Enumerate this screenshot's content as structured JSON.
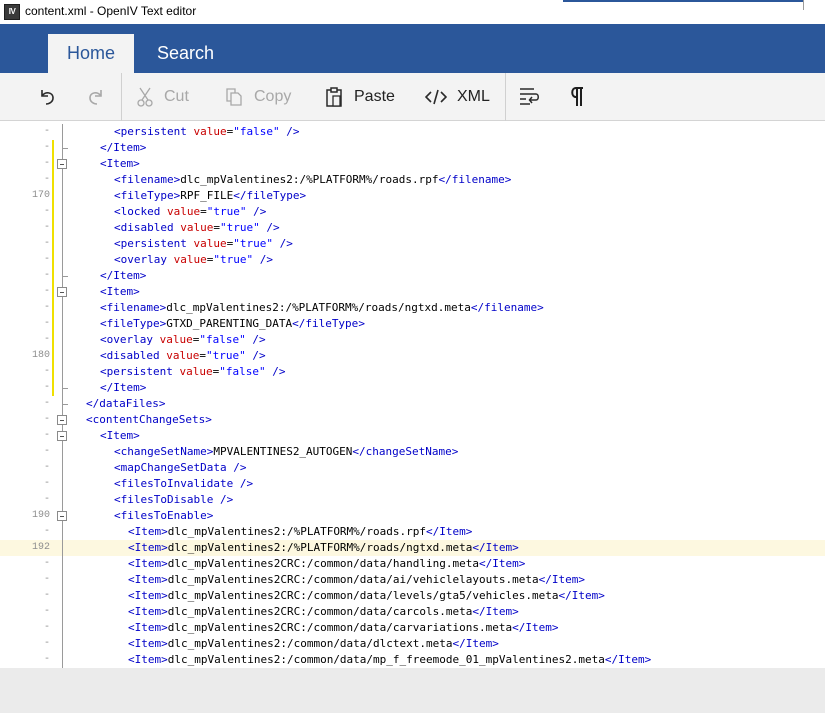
{
  "window": {
    "title": "content.xml - OpenIV Text editor",
    "icon_text": "IV"
  },
  "tabs": [
    {
      "label": "Home",
      "active": true
    },
    {
      "label": "Search",
      "active": false
    }
  ],
  "toolbar": {
    "undo_icon": "undo-icon",
    "redo_icon": "redo-icon",
    "cut_label": "Cut",
    "copy_label": "Copy",
    "paste_label": "Paste",
    "xml_label": "XML",
    "wrap_icon": "word-wrap-icon",
    "pilcrow_icon": "show-formatting-icon"
  },
  "colors": {
    "ribbon": "#2b579a",
    "tag": "#0000c8",
    "attr": "#c80000",
    "value": "#0000ff",
    "change_marker": "#f0e000",
    "current_line": "#fdf8e0"
  },
  "editor": {
    "current_line": 192,
    "lines": [
      {
        "n": "-",
        "depth": 2,
        "text": "<persistent value=\"false\" />"
      },
      {
        "n": "-",
        "depth": 1,
        "text": "</Item>"
      },
      {
        "n": "-",
        "depth": 1,
        "text": "<Item>"
      },
      {
        "n": "-",
        "depth": 2,
        "text": "<filename>dlc_mpValentines2:/%PLATFORM%/roads.rpf</filename>"
      },
      {
        "n": "170",
        "depth": 2,
        "text": "<fileType>RPF_FILE</fileType>"
      },
      {
        "n": "-",
        "depth": 2,
        "text": "<locked value=\"true\" />"
      },
      {
        "n": "-",
        "depth": 2,
        "text": "<disabled value=\"true\" />"
      },
      {
        "n": "-",
        "depth": 2,
        "text": "<persistent value=\"true\" />"
      },
      {
        "n": "-",
        "depth": 2,
        "text": "<overlay value=\"true\" />"
      },
      {
        "n": "-",
        "depth": 1,
        "text": "</Item>"
      },
      {
        "n": "-",
        "depth": 1,
        "text": "<Item>"
      },
      {
        "n": "-",
        "depth": 1,
        "text": "<filename>dlc_mpValentines2:/%PLATFORM%/roads/ngtxd.meta</filename>"
      },
      {
        "n": "-",
        "depth": 1,
        "text": "<fileType>GTXD_PARENTING_DATA</fileType>"
      },
      {
        "n": "-",
        "depth": 1,
        "text": "<overlay value=\"false\" />"
      },
      {
        "n": "180",
        "depth": 1,
        "text": "<disabled value=\"true\" />"
      },
      {
        "n": "-",
        "depth": 1,
        "text": "<persistent value=\"false\" />"
      },
      {
        "n": "-",
        "depth": 1,
        "text": "</Item>"
      },
      {
        "n": "-",
        "depth": 0,
        "text": "</dataFiles>"
      },
      {
        "n": "-",
        "depth": 0,
        "text": "<contentChangeSets>"
      },
      {
        "n": "-",
        "depth": 1,
        "text": "<Item>"
      },
      {
        "n": "-",
        "depth": 2,
        "text": "<changeSetName>MPVALENTINES2_AUTOGEN</changeSetName>"
      },
      {
        "n": "-",
        "depth": 2,
        "text": "<mapChangeSetData />"
      },
      {
        "n": "-",
        "depth": 2,
        "text": "<filesToInvalidate />"
      },
      {
        "n": "-",
        "depth": 2,
        "text": "<filesToDisable />"
      },
      {
        "n": "190",
        "depth": 2,
        "text": "<filesToEnable>"
      },
      {
        "n": "-",
        "depth": 3,
        "text": "<Item>dlc_mpValentines2:/%PLATFORM%/roads.rpf</Item>"
      },
      {
        "n": "192",
        "depth": 3,
        "text": "<Item>dlc_mpValentines2:/%PLATFORM%/roads/ngtxd.meta</Item>"
      },
      {
        "n": "-",
        "depth": 3,
        "text": "<Item>dlc_mpValentines2CRC:/common/data/handling.meta</Item>"
      },
      {
        "n": "-",
        "depth": 3,
        "text": "<Item>dlc_mpValentines2CRC:/common/data/ai/vehiclelayouts.meta</Item>"
      },
      {
        "n": "-",
        "depth": 3,
        "text": "<Item>dlc_mpValentines2CRC:/common/data/levels/gta5/vehicles.meta</Item>"
      },
      {
        "n": "-",
        "depth": 3,
        "text": "<Item>dlc_mpValentines2CRC:/common/data/carcols.meta</Item>"
      },
      {
        "n": "-",
        "depth": 3,
        "text": "<Item>dlc_mpValentines2CRC:/common/data/carvariations.meta</Item>"
      },
      {
        "n": "-",
        "depth": 3,
        "text": "<Item>dlc_mpValentines2:/common/data/dlctext.meta</Item>"
      },
      {
        "n": "-",
        "depth": 3,
        "text": "<Item>dlc_mpValentines2:/common/data/mp_f_freemode_01_mpValentines2.meta</Item>"
      }
    ]
  }
}
